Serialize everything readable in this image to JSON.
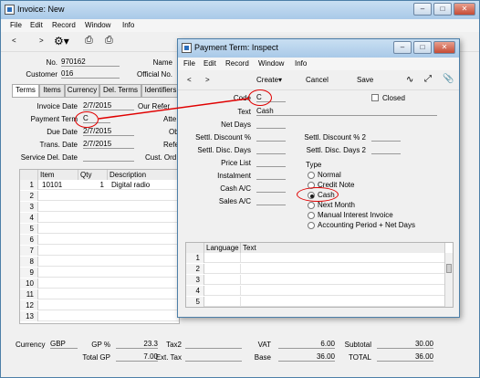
{
  "invoice": {
    "title": "Invoice: New",
    "menu": [
      "File",
      "Edit",
      "Record",
      "Window",
      "Info"
    ],
    "fields": {
      "no_label": "No.",
      "no": "970162",
      "name_label": "Name",
      "customer_label": "Customer",
      "customer": "016",
      "official_label": "Official No."
    },
    "tabs": [
      "Terms",
      "Items",
      "Currency",
      "Del. Terms",
      "Identifiers"
    ],
    "terms": {
      "invoice_date_label": "Invoice Date",
      "invoice_date": "2/7/2015",
      "our_ref_label": "Our Refer",
      "payment_term_label": "Payment Term",
      "payment_term": "C",
      "atte_label": "Atte",
      "due_date_label": "Due Date",
      "due_date": "2/7/2015",
      "ob_label": "Ob",
      "trans_date_label": "Trans. Date",
      "trans_date": "2/7/2015",
      "refe_label": "Refe",
      "service_del_label": "Service Del. Date",
      "cust_ord_label": "Cust. Ord"
    },
    "grid": {
      "headers": [
        "Item",
        "Qty",
        "Description"
      ],
      "rows": [
        {
          "n": "1",
          "item": "10101",
          "qty": "1",
          "desc": "Digital radio"
        },
        {
          "n": "2"
        },
        {
          "n": "3"
        },
        {
          "n": "4"
        },
        {
          "n": "5"
        },
        {
          "n": "6"
        },
        {
          "n": "7"
        },
        {
          "n": "8"
        },
        {
          "n": "9"
        },
        {
          "n": "10"
        },
        {
          "n": "11"
        },
        {
          "n": "12"
        },
        {
          "n": "13"
        }
      ]
    },
    "footer": {
      "currency_label": "Currency",
      "currency": "GBP",
      "gp_pct_label": "GP %",
      "gp_pct": "23.3",
      "tax2_label": "Tax2",
      "vat_label": "VAT",
      "vat": "6.00",
      "subtotal_label": "Subtotal",
      "subtotal": "30.00",
      "total_gp_label": "Total GP",
      "total_gp": "7.00",
      "ext_tax_label": "Ext. Tax",
      "base_label": "Base",
      "base": "36.00",
      "total_label": "TOTAL",
      "total": "36.00"
    }
  },
  "payment_term": {
    "title": "Payment Term: Inspect",
    "menu": [
      "File",
      "Edit",
      "Record",
      "Window",
      "Info"
    ],
    "toolbar": {
      "create": "Create",
      "cancel": "Cancel",
      "save": "Save"
    },
    "fields": {
      "code_label": "Code",
      "code": "C",
      "closed_label": "Closed",
      "text_label": "Text",
      "text": "Cash",
      "net_days_label": "Net Days",
      "settl_disc_label": "Settl. Discount %",
      "settl_disc2_label": "Settl. Discount % 2",
      "settl_days_label": "Settl. Disc. Days",
      "settl_days2_label": "Settl. Disc. Days 2",
      "price_list_label": "Price List",
      "instalment_label": "Instalment",
      "cash_ac_label": "Cash A/C",
      "sales_ac_label": "Sales A/C"
    },
    "type_label": "Type",
    "types": [
      "Normal",
      "Credit Note",
      "Cash",
      "Next Month",
      "Manual Interest Invoice",
      "Accounting Period + Net Days"
    ],
    "selected_type": "Cash",
    "grid": {
      "headers": [
        "Language",
        "Text"
      ],
      "rows": [
        "1",
        "2",
        "3",
        "4",
        "5"
      ]
    }
  },
  "colors": {
    "annotation": "#e00000",
    "title_bar": "#b9d4ee"
  }
}
